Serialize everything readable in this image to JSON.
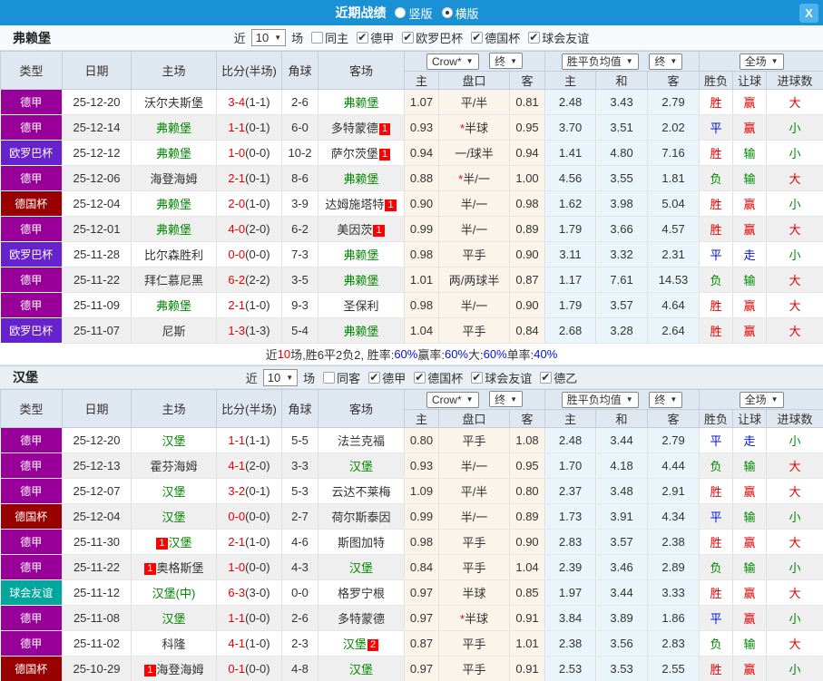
{
  "titlebar": {
    "title": "近期战绩",
    "vertical_label": "竖版",
    "horizontal_label": "横版",
    "vertical_checked": false,
    "horizontal_checked": true,
    "close_label": "X"
  },
  "colors": {
    "topbar_bg": "#1a91d4",
    "featured_team": "#008800",
    "score_ft": "#e60000",
    "badge_bg": "#ff0000",
    "summary_percent": "#0011dd",
    "type": {
      "德甲": "#990099",
      "欧罗巴杯": "#6622cc",
      "德国杯": "#990000",
      "球会友谊": "#00a79c"
    },
    "result_class": {
      "胜": "r",
      "平": "b",
      "负": "g",
      "赢": "r",
      "输": "g",
      "走": "b",
      "大": "r",
      "小": "g"
    }
  },
  "sections": [
    {
      "team": "弗赖堡",
      "filter": {
        "near_label": "近",
        "games_value": "10",
        "games_label": "场",
        "same_label": "同主",
        "same_checked": false,
        "leagues": [
          "德甲",
          "欧罗巴杯",
          "德国杯",
          "球会友谊"
        ]
      },
      "dropdowns": [
        "Crow*",
        "终",
        "胜平负均值",
        "终",
        "全场"
      ],
      "columns": [
        "类型",
        "日期",
        "主场",
        "比分(半场)",
        "角球",
        "客场",
        "主",
        "盘口",
        "客",
        "主",
        "和",
        "客",
        "胜负",
        "让球",
        "进球数"
      ],
      "rows": [
        {
          "type": "德甲",
          "date": "25-12-20",
          "home": {
            "name": "沃尔夫斯堡"
          },
          "score": {
            "ft": "3-4",
            "ht": "(1-1)"
          },
          "corners": "2-6",
          "away": {
            "name": "弗赖堡",
            "featured": true
          },
          "odds1": [
            "1.07",
            "平/半",
            "0.81"
          ],
          "odds2": [
            "2.48",
            "3.43",
            "2.79"
          ],
          "results": [
            "胜",
            "赢",
            "大"
          ]
        },
        {
          "type": "德甲",
          "date": "25-12-14",
          "home": {
            "name": "弗赖堡",
            "featured": true
          },
          "score": {
            "ft": "1-1",
            "ht": "(0-1)"
          },
          "corners": "6-0",
          "away": {
            "name": "多特蒙德",
            "badge": "1",
            "badge_pos": "after"
          },
          "odds1": [
            "0.93",
            "*半球",
            "0.95"
          ],
          "odds2": [
            "3.70",
            "3.51",
            "2.02"
          ],
          "results": [
            "平",
            "赢",
            "小"
          ]
        },
        {
          "type": "欧罗巴杯",
          "date": "25-12-12",
          "home": {
            "name": "弗赖堡",
            "featured": true
          },
          "score": {
            "ft": "1-0",
            "ht": "(0-0)"
          },
          "corners": "10-2",
          "away": {
            "name": "萨尔茨堡",
            "badge": "1",
            "badge_pos": "after"
          },
          "odds1": [
            "0.94",
            "一/球半",
            "0.94"
          ],
          "odds2": [
            "1.41",
            "4.80",
            "7.16"
          ],
          "results": [
            "胜",
            "输",
            "小"
          ]
        },
        {
          "type": "德甲",
          "date": "25-12-06",
          "home": {
            "name": "海登海姆"
          },
          "score": {
            "ft": "2-1",
            "ht": "(0-1)"
          },
          "corners": "8-6",
          "away": {
            "name": "弗赖堡",
            "featured": true
          },
          "odds1": [
            "0.88",
            "*半/一",
            "1.00"
          ],
          "odds2": [
            "4.56",
            "3.55",
            "1.81"
          ],
          "results": [
            "负",
            "输",
            "大"
          ]
        },
        {
          "type": "德国杯",
          "date": "25-12-04",
          "home": {
            "name": "弗赖堡",
            "featured": true
          },
          "score": {
            "ft": "2-0",
            "ht": "(1-0)"
          },
          "corners": "3-9",
          "away": {
            "name": "达姆施塔特",
            "badge": "1",
            "badge_pos": "after"
          },
          "odds1": [
            "0.90",
            "半/一",
            "0.98"
          ],
          "odds2": [
            "1.62",
            "3.98",
            "5.04"
          ],
          "results": [
            "胜",
            "赢",
            "小"
          ]
        },
        {
          "type": "德甲",
          "date": "25-12-01",
          "home": {
            "name": "弗赖堡",
            "featured": true
          },
          "score": {
            "ft": "4-0",
            "ht": "(2-0)"
          },
          "corners": "6-2",
          "away": {
            "name": "美因茨",
            "badge": "1",
            "badge_pos": "after"
          },
          "odds1": [
            "0.99",
            "半/一",
            "0.89"
          ],
          "odds2": [
            "1.79",
            "3.66",
            "4.57"
          ],
          "results": [
            "胜",
            "赢",
            "大"
          ]
        },
        {
          "type": "欧罗巴杯",
          "date": "25-11-28",
          "home": {
            "name": "比尔森胜利"
          },
          "score": {
            "ft": "0-0",
            "ht": "(0-0)"
          },
          "corners": "7-3",
          "away": {
            "name": "弗赖堡",
            "featured": true
          },
          "odds1": [
            "0.98",
            "平手",
            "0.90"
          ],
          "odds2": [
            "3.11",
            "3.32",
            "2.31"
          ],
          "results": [
            "平",
            "走",
            "小"
          ]
        },
        {
          "type": "德甲",
          "date": "25-11-22",
          "home": {
            "name": "拜仁慕尼黑"
          },
          "score": {
            "ft": "6-2",
            "ht": "(2-2)"
          },
          "corners": "3-5",
          "away": {
            "name": "弗赖堡",
            "featured": true
          },
          "odds1": [
            "1.01",
            "两/两球半",
            "0.87"
          ],
          "odds2": [
            "1.17",
            "7.61",
            "14.53"
          ],
          "results": [
            "负",
            "输",
            "大"
          ]
        },
        {
          "type": "德甲",
          "date": "25-11-09",
          "home": {
            "name": "弗赖堡",
            "featured": true
          },
          "score": {
            "ft": "2-1",
            "ht": "(1-0)"
          },
          "corners": "9-3",
          "away": {
            "name": "圣保利"
          },
          "odds1": [
            "0.98",
            "半/一",
            "0.90"
          ],
          "odds2": [
            "1.79",
            "3.57",
            "4.64"
          ],
          "results": [
            "胜",
            "赢",
            "大"
          ]
        },
        {
          "type": "欧罗巴杯",
          "date": "25-11-07",
          "home": {
            "name": "尼斯"
          },
          "score": {
            "ft": "1-3",
            "ht": "(1-3)"
          },
          "corners": "5-4",
          "away": {
            "name": "弗赖堡",
            "featured": true
          },
          "odds1": [
            "1.04",
            "平手",
            "0.84"
          ],
          "odds2": [
            "2.68",
            "3.28",
            "2.64"
          ],
          "results": [
            "胜",
            "赢",
            "大"
          ]
        }
      ],
      "summary": [
        {
          "text": "近",
          "cls": "n"
        },
        {
          "text": "10",
          "cls": "r"
        },
        {
          "text": "场,胜6平2负2, 胜率:",
          "cls": "n"
        },
        {
          "text": "60%",
          "cls": "b"
        },
        {
          "text": " 赢率:",
          "cls": "n"
        },
        {
          "text": "60%",
          "cls": "b"
        },
        {
          "text": " 大:",
          "cls": "n"
        },
        {
          "text": "60%",
          "cls": "b"
        },
        {
          "text": " 单率:",
          "cls": "n"
        },
        {
          "text": "40%",
          "cls": "b"
        }
      ]
    },
    {
      "team": "汉堡",
      "filter": {
        "near_label": "近",
        "games_value": "10",
        "games_label": "场",
        "same_label": "同客",
        "same_checked": false,
        "leagues": [
          "德甲",
          "德国杯",
          "球会友谊",
          "德乙"
        ]
      },
      "dropdowns": [
        "Crow*",
        "终",
        "胜平负均值",
        "终",
        "全场"
      ],
      "columns": [
        "类型",
        "日期",
        "主场",
        "比分(半场)",
        "角球",
        "客场",
        "主",
        "盘口",
        "客",
        "主",
        "和",
        "客",
        "胜负",
        "让球",
        "进球数"
      ],
      "rows": [
        {
          "type": "德甲",
          "date": "25-12-20",
          "home": {
            "name": "汉堡",
            "featured": true
          },
          "score": {
            "ft": "1-1",
            "ht": "(1-1)"
          },
          "corners": "5-5",
          "away": {
            "name": "法兰克福"
          },
          "odds1": [
            "0.80",
            "平手",
            "1.08"
          ],
          "odds2": [
            "2.48",
            "3.44",
            "2.79"
          ],
          "results": [
            "平",
            "走",
            "小"
          ]
        },
        {
          "type": "德甲",
          "date": "25-12-13",
          "home": {
            "name": "霍芬海姆"
          },
          "score": {
            "ft": "4-1",
            "ht": "(2-0)"
          },
          "corners": "3-3",
          "away": {
            "name": "汉堡",
            "featured": true
          },
          "odds1": [
            "0.93",
            "半/一",
            "0.95"
          ],
          "odds2": [
            "1.70",
            "4.18",
            "4.44"
          ],
          "results": [
            "负",
            "输",
            "大"
          ]
        },
        {
          "type": "德甲",
          "date": "25-12-07",
          "home": {
            "name": "汉堡",
            "featured": true
          },
          "score": {
            "ft": "3-2",
            "ht": "(0-1)"
          },
          "corners": "5-3",
          "away": {
            "name": "云达不莱梅"
          },
          "odds1": [
            "1.09",
            "平/半",
            "0.80"
          ],
          "odds2": [
            "2.37",
            "3.48",
            "2.91"
          ],
          "results": [
            "胜",
            "赢",
            "大"
          ]
        },
        {
          "type": "德国杯",
          "date": "25-12-04",
          "home": {
            "name": "汉堡",
            "featured": true
          },
          "score": {
            "ft": "0-0",
            "ht": "(0-0)"
          },
          "corners": "2-7",
          "away": {
            "name": "荷尔斯泰因"
          },
          "odds1": [
            "0.99",
            "半/一",
            "0.89"
          ],
          "odds2": [
            "1.73",
            "3.91",
            "4.34"
          ],
          "results": [
            "平",
            "输",
            "小"
          ]
        },
        {
          "type": "德甲",
          "date": "25-11-30",
          "home": {
            "name": "汉堡",
            "featured": true,
            "badge": "1",
            "badge_pos": "before"
          },
          "score": {
            "ft": "2-1",
            "ht": "(1-0)"
          },
          "corners": "4-6",
          "away": {
            "name": "斯图加特"
          },
          "odds1": [
            "0.98",
            "平手",
            "0.90"
          ],
          "odds2": [
            "2.83",
            "3.57",
            "2.38"
          ],
          "results": [
            "胜",
            "赢",
            "大"
          ]
        },
        {
          "type": "德甲",
          "date": "25-11-22",
          "home": {
            "name": "奥格斯堡",
            "badge": "1",
            "badge_pos": "before"
          },
          "score": {
            "ft": "1-0",
            "ht": "(0-0)"
          },
          "corners": "4-3",
          "away": {
            "name": "汉堡",
            "featured": true
          },
          "odds1": [
            "0.84",
            "平手",
            "1.04"
          ],
          "odds2": [
            "2.39",
            "3.46",
            "2.89"
          ],
          "results": [
            "负",
            "输",
            "小"
          ]
        },
        {
          "type": "球会友谊",
          "date": "25-11-12",
          "home": {
            "name": "汉堡(中)",
            "featured": true
          },
          "score": {
            "ft": "6-3",
            "ht": "(3-0)"
          },
          "corners": "0-0",
          "away": {
            "name": "格罗宁根"
          },
          "odds1": [
            "0.97",
            "半球",
            "0.85"
          ],
          "odds2": [
            "1.97",
            "3.44",
            "3.33"
          ],
          "results": [
            "胜",
            "赢",
            "大"
          ]
        },
        {
          "type": "德甲",
          "date": "25-11-08",
          "home": {
            "name": "汉堡",
            "featured": true
          },
          "score": {
            "ft": "1-1",
            "ht": "(0-0)"
          },
          "corners": "2-6",
          "away": {
            "name": "多特蒙德"
          },
          "odds1": [
            "0.97",
            "*半球",
            "0.91"
          ],
          "odds2": [
            "3.84",
            "3.89",
            "1.86"
          ],
          "results": [
            "平",
            "赢",
            "小"
          ]
        },
        {
          "type": "德甲",
          "date": "25-11-02",
          "home": {
            "name": "科隆"
          },
          "score": {
            "ft": "4-1",
            "ht": "(1-0)"
          },
          "corners": "2-3",
          "away": {
            "name": "汉堡",
            "featured": true,
            "badge": "2",
            "badge_pos": "after"
          },
          "odds1": [
            "0.87",
            "平手",
            "1.01"
          ],
          "odds2": [
            "2.38",
            "3.56",
            "2.83"
          ],
          "results": [
            "负",
            "输",
            "大"
          ]
        },
        {
          "type": "德国杯",
          "date": "25-10-29",
          "home": {
            "name": "海登海姆",
            "badge": "1",
            "badge_pos": "before"
          },
          "score": {
            "ft": "0-1",
            "ht": "(0-0)"
          },
          "corners": "4-8",
          "away": {
            "name": "汉堡",
            "featured": true
          },
          "odds1": [
            "0.97",
            "平手",
            "0.91"
          ],
          "odds2": [
            "2.53",
            "3.53",
            "2.55"
          ],
          "results": [
            "胜",
            "赢",
            "小"
          ]
        }
      ]
    }
  ]
}
